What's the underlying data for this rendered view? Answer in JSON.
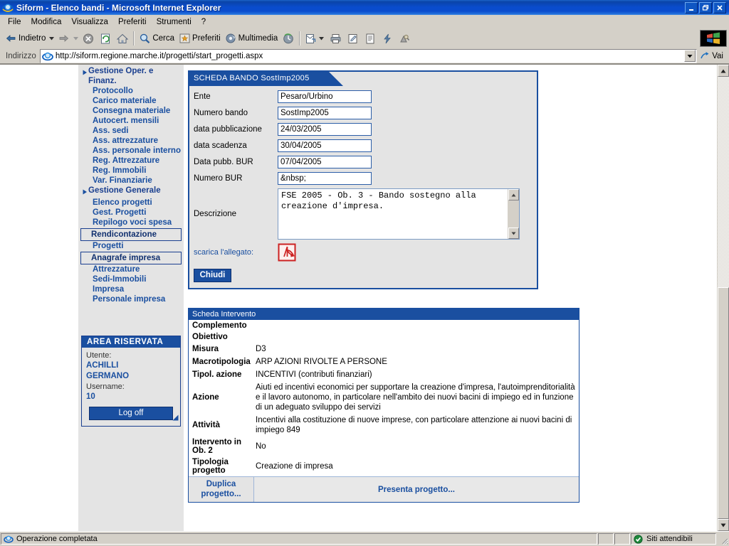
{
  "window": {
    "title": "Siform - Elenco bandi - Microsoft Internet Explorer",
    "app_icon": "ie-icon",
    "buttons": {
      "minimize": "minimize-button",
      "restore": "restore-button",
      "close": "close-button"
    }
  },
  "menubar": {
    "items": [
      {
        "label": "File"
      },
      {
        "label": "Modifica"
      },
      {
        "label": "Visualizza"
      },
      {
        "label": "Preferiti"
      },
      {
        "label": "Strumenti"
      },
      {
        "label": "?"
      }
    ]
  },
  "toolbar": {
    "back_label": "Indietro",
    "forward_label": "",
    "stop_label": "",
    "refresh_label": "",
    "home_label": "",
    "search_label": "Cerca",
    "favorites_label": "Preferiti",
    "media_label": "Multimedia",
    "history_label": "",
    "mail_label": "",
    "print_label": "",
    "edit_label": "",
    "discuss_label": "",
    "messenger_label": "",
    "research_label": ""
  },
  "address": {
    "label": "Indirizzo",
    "url": "http://siform.regione.marche.it/progetti/start_progetti.aspx",
    "go_label": "Vai"
  },
  "sidebar": {
    "nav": [
      {
        "type": "group",
        "label": "Gestione Oper. e Finanz."
      },
      {
        "type": "link",
        "label": "Protocollo"
      },
      {
        "type": "link",
        "label": "Carico materiale"
      },
      {
        "type": "link",
        "label": "Consegna materiale"
      },
      {
        "type": "link",
        "label": "Autocert. mensili"
      },
      {
        "type": "link",
        "label": "Ass. sedi"
      },
      {
        "type": "link",
        "label": "Ass. attrezzature"
      },
      {
        "type": "link",
        "label": "Ass. personale interno"
      },
      {
        "type": "link",
        "label": "Reg. Attrezzature"
      },
      {
        "type": "link",
        "label": "Reg. Immobili"
      },
      {
        "type": "link",
        "label": "Var. Finanziarie"
      },
      {
        "type": "group",
        "label": "Gestione Generale"
      },
      {
        "type": "link",
        "label": "Elenco progetti"
      },
      {
        "type": "link",
        "label": "Gest. Progetti"
      },
      {
        "type": "link",
        "label": "Repilogo voci spesa"
      },
      {
        "type": "box",
        "label": "Rendicontazione"
      },
      {
        "type": "link",
        "label": "Progetti"
      },
      {
        "type": "box",
        "label": "Anagrafe impresa"
      },
      {
        "type": "link",
        "label": "Attrezzature"
      },
      {
        "type": "link",
        "label": "Sedi-Immobili"
      },
      {
        "type": "link",
        "label": "Impresa"
      },
      {
        "type": "link",
        "label": "Personale impresa"
      }
    ],
    "area_riservata": {
      "title": "AREA RISERVATA",
      "user_label": "Utente:",
      "user_name_line1": "ACHILLI",
      "user_name_line2": "GERMANO",
      "username_label": "Username:",
      "username_value": "10",
      "logoff_label": "Log off"
    }
  },
  "bando_panel": {
    "tab_title": "SCHEDA BANDO SostImp2005",
    "fields": [
      {
        "label": "Ente",
        "value": "Pesaro/Urbino"
      },
      {
        "label": "Numero bando",
        "value": "SostImp2005"
      },
      {
        "label": "data pubblicazione",
        "value": "24/03/2005"
      },
      {
        "label": "data scadenza",
        "value": "30/04/2005"
      },
      {
        "label": "Data pubb. BUR",
        "value": "07/04/2005"
      },
      {
        "label": "Numero BUR",
        "value": "&nbsp;"
      }
    ],
    "description_label": "Descrizione",
    "description_value": "FSE 2005 - Ob. 3 - Bando sostegno alla\ncreazione d'impresa.",
    "attachment_label": "scarica l'allegato:",
    "attachment_icon": "pdf-icon",
    "close_label": "Chiudi"
  },
  "intervento_panel": {
    "title": "Scheda Intervento",
    "rows": [
      {
        "key": "Complemento",
        "value": ""
      },
      {
        "key": "Obiettivo",
        "value": ""
      },
      {
        "key": "Misura",
        "value": "D3"
      },
      {
        "key": "Macrotipologia",
        "value": "ARP AZIONI RIVOLTE A PERSONE"
      },
      {
        "key": "Tipol. azione",
        "value": "INCENTIVI (contributi finanziari)"
      },
      {
        "key": "Azione",
        "value": "Aiuti ed incentivi economici per supportare la creazione d'impresa, l'autoimprenditorialità e il lavoro autonomo, in particolare nell'ambito dei nuovi bacini di impiego ed in funzione di un adeguato sviluppo dei servizi"
      },
      {
        "key": "Attività",
        "value": "Incentivi alla costituzione di nuove imprese, con particolare attenzione ai nuovi bacini di impiego 849"
      },
      {
        "key": "Intervento in Ob. 2",
        "value": "No"
      },
      {
        "key": "Tipologia progetto",
        "value": "Creazione di impresa"
      }
    ],
    "duplicate_label": "Duplica progetto...",
    "present_label": "Presenta progetto..."
  },
  "statusbar": {
    "message": "Operazione completata",
    "zone": "Siti attendibili",
    "zone_icon": "trusted-sites-icon"
  },
  "colors": {
    "accent_blue": "#1a4fa0",
    "title_blue": "#0a4ccd",
    "chrome_gray": "#d4d0c8",
    "sidebar_gray": "#e4e4e4",
    "link_blue": "#1a4fa0"
  }
}
